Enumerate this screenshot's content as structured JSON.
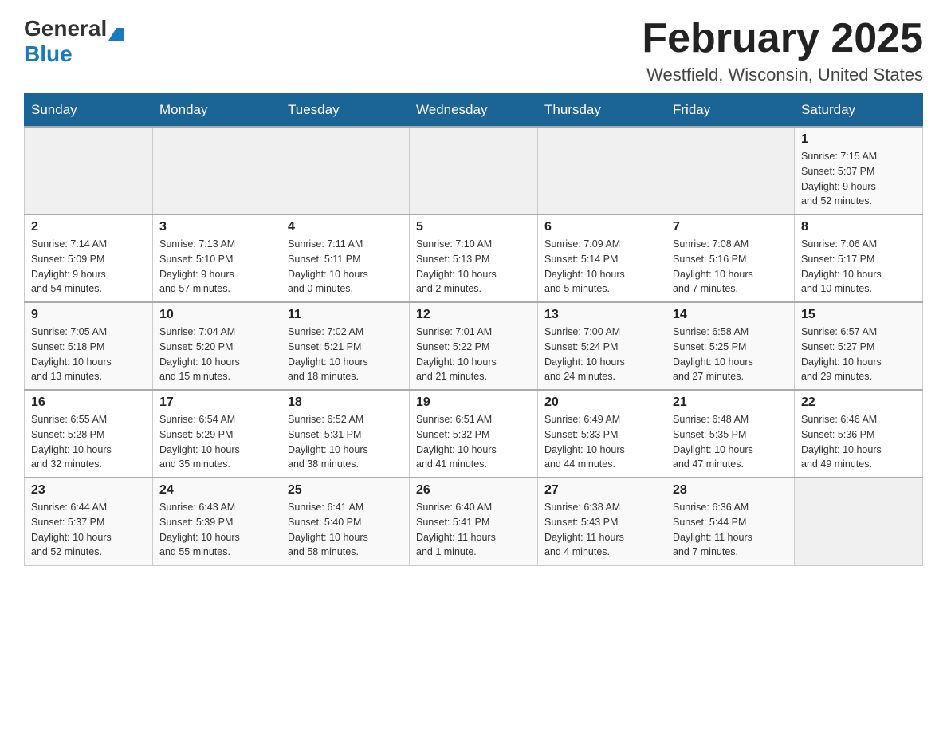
{
  "header": {
    "logo_general": "General",
    "logo_blue": "Blue",
    "month_title": "February 2025",
    "location": "Westfield, Wisconsin, United States"
  },
  "days_of_week": [
    "Sunday",
    "Monday",
    "Tuesday",
    "Wednesday",
    "Thursday",
    "Friday",
    "Saturday"
  ],
  "weeks": [
    [
      {
        "day": "",
        "info": ""
      },
      {
        "day": "",
        "info": ""
      },
      {
        "day": "",
        "info": ""
      },
      {
        "day": "",
        "info": ""
      },
      {
        "day": "",
        "info": ""
      },
      {
        "day": "",
        "info": ""
      },
      {
        "day": "1",
        "info": "Sunrise: 7:15 AM\nSunset: 5:07 PM\nDaylight: 9 hours\nand 52 minutes."
      }
    ],
    [
      {
        "day": "2",
        "info": "Sunrise: 7:14 AM\nSunset: 5:09 PM\nDaylight: 9 hours\nand 54 minutes."
      },
      {
        "day": "3",
        "info": "Sunrise: 7:13 AM\nSunset: 5:10 PM\nDaylight: 9 hours\nand 57 minutes."
      },
      {
        "day": "4",
        "info": "Sunrise: 7:11 AM\nSunset: 5:11 PM\nDaylight: 10 hours\nand 0 minutes."
      },
      {
        "day": "5",
        "info": "Sunrise: 7:10 AM\nSunset: 5:13 PM\nDaylight: 10 hours\nand 2 minutes."
      },
      {
        "day": "6",
        "info": "Sunrise: 7:09 AM\nSunset: 5:14 PM\nDaylight: 10 hours\nand 5 minutes."
      },
      {
        "day": "7",
        "info": "Sunrise: 7:08 AM\nSunset: 5:16 PM\nDaylight: 10 hours\nand 7 minutes."
      },
      {
        "day": "8",
        "info": "Sunrise: 7:06 AM\nSunset: 5:17 PM\nDaylight: 10 hours\nand 10 minutes."
      }
    ],
    [
      {
        "day": "9",
        "info": "Sunrise: 7:05 AM\nSunset: 5:18 PM\nDaylight: 10 hours\nand 13 minutes."
      },
      {
        "day": "10",
        "info": "Sunrise: 7:04 AM\nSunset: 5:20 PM\nDaylight: 10 hours\nand 15 minutes."
      },
      {
        "day": "11",
        "info": "Sunrise: 7:02 AM\nSunset: 5:21 PM\nDaylight: 10 hours\nand 18 minutes."
      },
      {
        "day": "12",
        "info": "Sunrise: 7:01 AM\nSunset: 5:22 PM\nDaylight: 10 hours\nand 21 minutes."
      },
      {
        "day": "13",
        "info": "Sunrise: 7:00 AM\nSunset: 5:24 PM\nDaylight: 10 hours\nand 24 minutes."
      },
      {
        "day": "14",
        "info": "Sunrise: 6:58 AM\nSunset: 5:25 PM\nDaylight: 10 hours\nand 27 minutes."
      },
      {
        "day": "15",
        "info": "Sunrise: 6:57 AM\nSunset: 5:27 PM\nDaylight: 10 hours\nand 29 minutes."
      }
    ],
    [
      {
        "day": "16",
        "info": "Sunrise: 6:55 AM\nSunset: 5:28 PM\nDaylight: 10 hours\nand 32 minutes."
      },
      {
        "day": "17",
        "info": "Sunrise: 6:54 AM\nSunset: 5:29 PM\nDaylight: 10 hours\nand 35 minutes."
      },
      {
        "day": "18",
        "info": "Sunrise: 6:52 AM\nSunset: 5:31 PM\nDaylight: 10 hours\nand 38 minutes."
      },
      {
        "day": "19",
        "info": "Sunrise: 6:51 AM\nSunset: 5:32 PM\nDaylight: 10 hours\nand 41 minutes."
      },
      {
        "day": "20",
        "info": "Sunrise: 6:49 AM\nSunset: 5:33 PM\nDaylight: 10 hours\nand 44 minutes."
      },
      {
        "day": "21",
        "info": "Sunrise: 6:48 AM\nSunset: 5:35 PM\nDaylight: 10 hours\nand 47 minutes."
      },
      {
        "day": "22",
        "info": "Sunrise: 6:46 AM\nSunset: 5:36 PM\nDaylight: 10 hours\nand 49 minutes."
      }
    ],
    [
      {
        "day": "23",
        "info": "Sunrise: 6:44 AM\nSunset: 5:37 PM\nDaylight: 10 hours\nand 52 minutes."
      },
      {
        "day": "24",
        "info": "Sunrise: 6:43 AM\nSunset: 5:39 PM\nDaylight: 10 hours\nand 55 minutes."
      },
      {
        "day": "25",
        "info": "Sunrise: 6:41 AM\nSunset: 5:40 PM\nDaylight: 10 hours\nand 58 minutes."
      },
      {
        "day": "26",
        "info": "Sunrise: 6:40 AM\nSunset: 5:41 PM\nDaylight: 11 hours\nand 1 minute."
      },
      {
        "day": "27",
        "info": "Sunrise: 6:38 AM\nSunset: 5:43 PM\nDaylight: 11 hours\nand 4 minutes."
      },
      {
        "day": "28",
        "info": "Sunrise: 6:36 AM\nSunset: 5:44 PM\nDaylight: 11 hours\nand 7 minutes."
      },
      {
        "day": "",
        "info": ""
      }
    ]
  ]
}
